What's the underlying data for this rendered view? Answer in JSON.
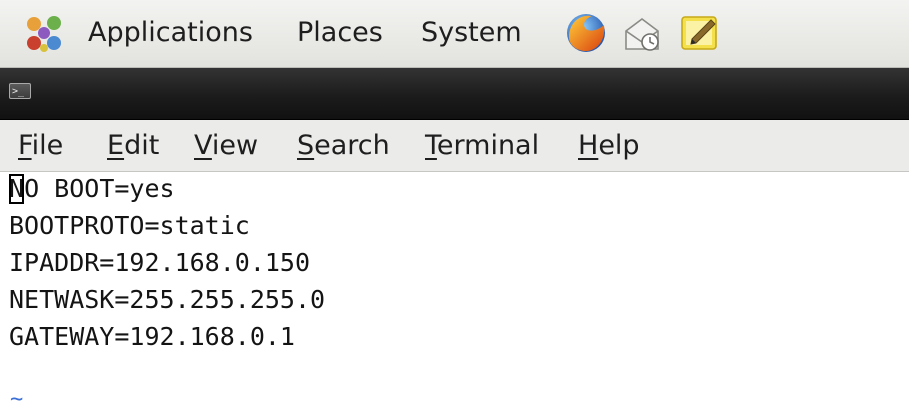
{
  "panel": {
    "menus": [
      "Applications",
      "Places",
      "System"
    ],
    "launchers": [
      "firefox-icon",
      "mail-icon",
      "notes-icon"
    ]
  },
  "terminal": {
    "icon": "terminal-icon",
    "menu": {
      "file": {
        "accel": "F",
        "rest": "ile"
      },
      "edit": {
        "accel": "E",
        "rest": "dit"
      },
      "view": {
        "accel": "V",
        "rest": "iew"
      },
      "search": {
        "accel": "S",
        "rest": "earch"
      },
      "terminal": {
        "accel": "T",
        "rest": "erminal"
      },
      "help": {
        "accel": "H",
        "rest": "elp"
      }
    },
    "lines": {
      "cursor_char": "N",
      "line1_rest": "O BOOT=yes",
      "line2": "BOOTPROTO=static",
      "line3": "IPADDR=192.168.0.150",
      "line4": "NETWASK=255.255.255.0",
      "line5": "GATEWAY=192.168.0.1"
    },
    "empty_line_marker": "~"
  }
}
